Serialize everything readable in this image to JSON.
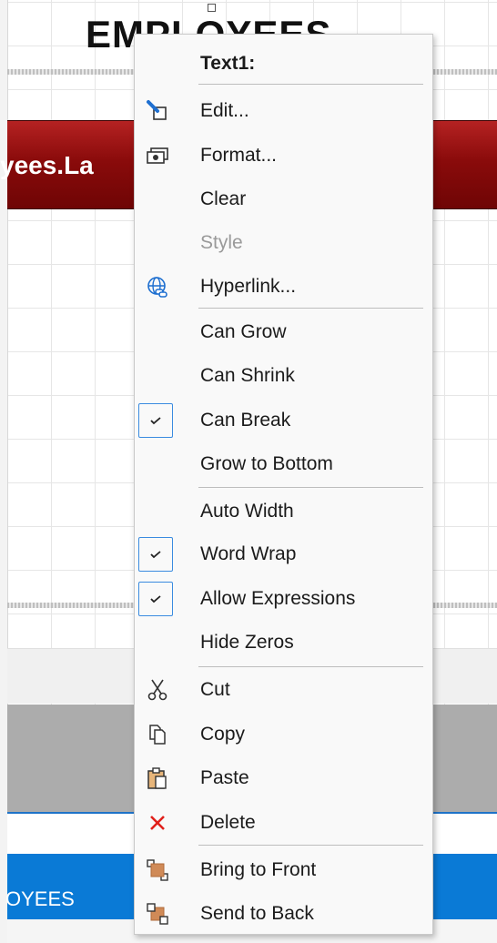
{
  "background": {
    "title": "EMPLOYEES",
    "field_text": "yees.La",
    "footer_text": "OYEES"
  },
  "menu": {
    "header": "Text1:",
    "items": [
      {
        "label": "Edit...",
        "icon": "edit-icon"
      },
      {
        "label": "Format...",
        "icon": "format-icon"
      },
      {
        "label": "Clear"
      },
      {
        "label": "Style",
        "disabled": true
      },
      {
        "label": "Hyperlink...",
        "icon": "hyperlink-icon"
      },
      {
        "label": "Can Grow"
      },
      {
        "label": "Can Shrink"
      },
      {
        "label": "Can Break",
        "checked": true
      },
      {
        "label": "Grow to Bottom"
      },
      {
        "label": "Auto Width"
      },
      {
        "label": "Word Wrap",
        "checked": true
      },
      {
        "label": "Allow Expressions",
        "checked": true
      },
      {
        "label": "Hide Zeros"
      },
      {
        "label": "Cut",
        "icon": "cut-icon"
      },
      {
        "label": "Copy",
        "icon": "copy-icon"
      },
      {
        "label": "Paste",
        "icon": "paste-icon"
      },
      {
        "label": "Delete",
        "icon": "delete-icon"
      },
      {
        "label": "Bring to Front",
        "icon": "bring-to-front-icon"
      },
      {
        "label": "Send to Back",
        "icon": "send-to-back-icon"
      }
    ]
  },
  "colors": {
    "header_band": "#8a0b0b",
    "footer_band": "#0a7ad6",
    "check_border": "#3a8be0",
    "delete": "#e0201b"
  }
}
